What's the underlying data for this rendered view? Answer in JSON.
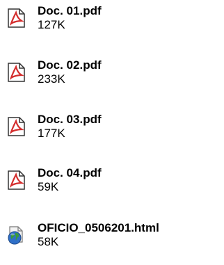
{
  "files": [
    {
      "name": "Doc. 01.pdf",
      "size": "127K",
      "icon": "pdf-icon"
    },
    {
      "name": "Doc. 02.pdf",
      "size": "233K",
      "icon": "pdf-icon"
    },
    {
      "name": "Doc. 03.pdf",
      "size": "177K",
      "icon": "pdf-icon"
    },
    {
      "name": "Doc. 04.pdf",
      "size": "59K",
      "icon": "pdf-icon"
    },
    {
      "name": "OFICIO_0506201.html",
      "size": "58K",
      "icon": "html-globe-icon"
    }
  ],
  "colors": {
    "pdf_red": "#d42d2d",
    "globe_blue": "#2f6fc8",
    "globe_green": "#3a9a3a"
  }
}
